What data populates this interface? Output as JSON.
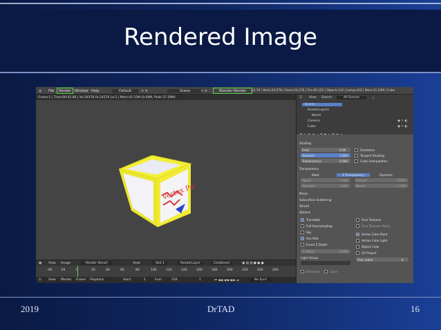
{
  "slide": {
    "title": "Rendered Image",
    "footer_left": "2019",
    "footer_center": "DrTAD",
    "footer_right": "16"
  },
  "blender": {
    "topbar": {
      "file": "File",
      "render": "Render",
      "window": "Window",
      "help": "Help",
      "layout": "Default",
      "scene": "Scene",
      "engine": "Blender Render",
      "stats": "v2.79 | Verts:24,578 | Faces:24,576 | Tris:49,152 | Objects:1/4 | Lamps:0/2 | Mem:41.53M | Cube"
    },
    "render_info": "Frame:1 | Time:00:02.86 | Ve:24578 Fa:24576 La:2 | Mem:41.53M (0.00M, Peak 57.29M)",
    "cube_text": "Vertex Paint",
    "image_header": {
      "view": "View",
      "image": "Image",
      "result": "Render Result",
      "view2": "View",
      "slot": "Slot 1",
      "layer": "RenderLayer",
      "combined": "Combined"
    },
    "timeline_numbers": [
      "-40",
      "-20",
      "0",
      "20",
      "40",
      "60",
      "80",
      "100",
      "120",
      "140",
      "160",
      "180",
      "200",
      "220",
      "240",
      "260"
    ],
    "timeline_bar": {
      "view": "View",
      "marker": "Marker",
      "frame": "Frame",
      "playback": "Playback",
      "start_label": "Start:",
      "start": "1",
      "end_label": "End:",
      "end": "250",
      "current": "1",
      "sync": "No Sync"
    },
    "outliner": {
      "view": "View",
      "search": "Search",
      "scenes": "All Scenes",
      "items": [
        "Scene",
        "RenderLayers",
        "World",
        "Camera",
        "Cube"
      ]
    },
    "props": {
      "shading": "Shading",
      "emit_label": "Emit:",
      "emit": "0.00",
      "ambient_label": "Ambient:",
      "ambient": "1.000",
      "translucency_label": "Translucency:",
      "translucency": "0.000",
      "shadeless": "Shadeless",
      "tangent": "Tangent Shading",
      "cubic": "Cubic Interpolation",
      "transparency": "Transparency",
      "mask": "Mask",
      "ztrans": "Z Transparency",
      "raytrace": "Raytrace",
      "alpha_label": "Alpha:",
      "alpha": "1.000",
      "fresnel_label": "Fresnel:",
      "fresnel": "0.000",
      "specular_label": "Specular:",
      "specular": "1.000",
      "blend_label": "Blend:",
      "blend": "1.250",
      "mirror": "Mirror",
      "sss": "Subsurface Scattering",
      "strand": "Strand",
      "options": "Options",
      "traceable": "Traceable",
      "full_over": "Full Oversampling",
      "sky": "Sky",
      "use_mist": "Use Mist",
      "invert_z": "Invert Z Depth",
      "zoffset_label": "Z Offset:",
      "zoffset": "0.000",
      "light_group": "Light Group:",
      "face_textures": "Face Textures",
      "face_tex_alpha": "Face Textures Alpha",
      "vcol_paint": "Vertex Color Paint",
      "vcol_light": "Vertex Color Light",
      "object_color": "Object Color",
      "uv_project": "UV Project",
      "pass_index": "Pass Index:",
      "pass_index_value": "0",
      "exclusive": "Exclusive",
      "local": "Local"
    }
  }
}
